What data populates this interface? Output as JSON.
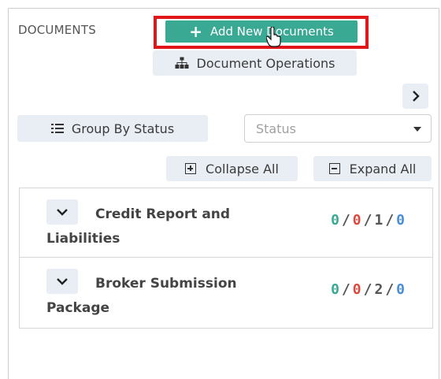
{
  "panel": {
    "title": "DOCUMENTS",
    "add_button_label": "Add New Documents",
    "operations_button_label": "Document Operations",
    "group_by_label": "Group By Status",
    "status_placeholder": "Status",
    "collapse_all_label": "Collapse All",
    "expand_all_label": "Expand All"
  },
  "documents": [
    {
      "name": "Credit Report and Liabilities",
      "counts": [
        "0",
        "0",
        "1",
        "0"
      ]
    },
    {
      "name": "Broker Submission Package",
      "counts": [
        "0",
        "0",
        "2",
        "0"
      ]
    }
  ],
  "colors": {
    "accent": "#3aa994",
    "highlight": "#e0161b",
    "count_green": "#3aa994",
    "count_red": "#e0473d",
    "count_blue": "#4a8fd6"
  },
  "icons": {
    "add": "plus-icon",
    "operations": "sitemap-icon",
    "group": "list-icon",
    "next": "chevron-right-icon",
    "collapse": "square-plus-icon",
    "expand": "square-minus-icon",
    "toggle": "chevron-down-icon",
    "cursor": "hand-pointer-icon"
  }
}
